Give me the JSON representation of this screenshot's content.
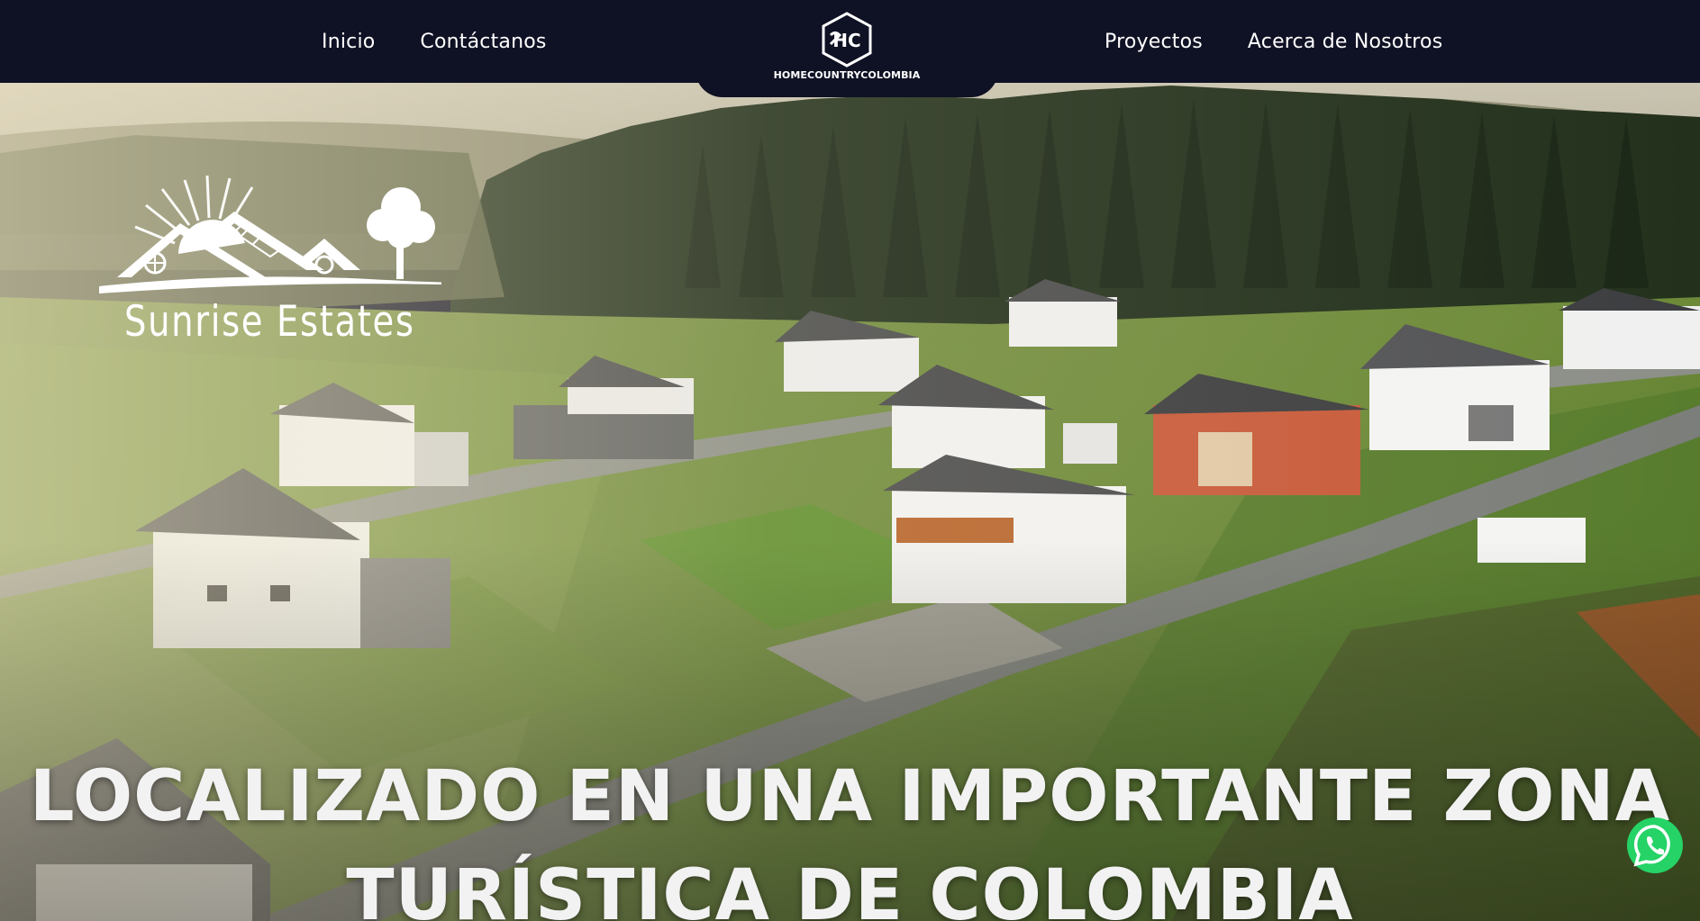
{
  "nav": {
    "left_links": [
      {
        "label": "Inicio"
      },
      {
        "label": "Contáctanos"
      }
    ],
    "right_links": [
      {
        "label": "Proyectos"
      },
      {
        "label": "Acerca de Nosotros"
      }
    ],
    "brand": {
      "name": "HOMECOUNTRYCOLOMBIA",
      "icon": "hch-hexagon-logo-icon"
    }
  },
  "hero": {
    "project_logo": {
      "name": "Sunrise Estates",
      "icon": "house-sun-tree-logo-icon"
    },
    "headline": {
      "line1": "LOCALIZADO EN UNA IMPORTANTE ZONA",
      "line2": "TURÍSTICA DE COLOMBIA"
    }
  },
  "floating": {
    "whatsapp_icon": "whatsapp-icon",
    "whatsapp_color": "#25d366"
  },
  "colors": {
    "nav_background": "#0f1124",
    "nav_text": "#ffffff",
    "headline_text": "#f2f2f2"
  }
}
